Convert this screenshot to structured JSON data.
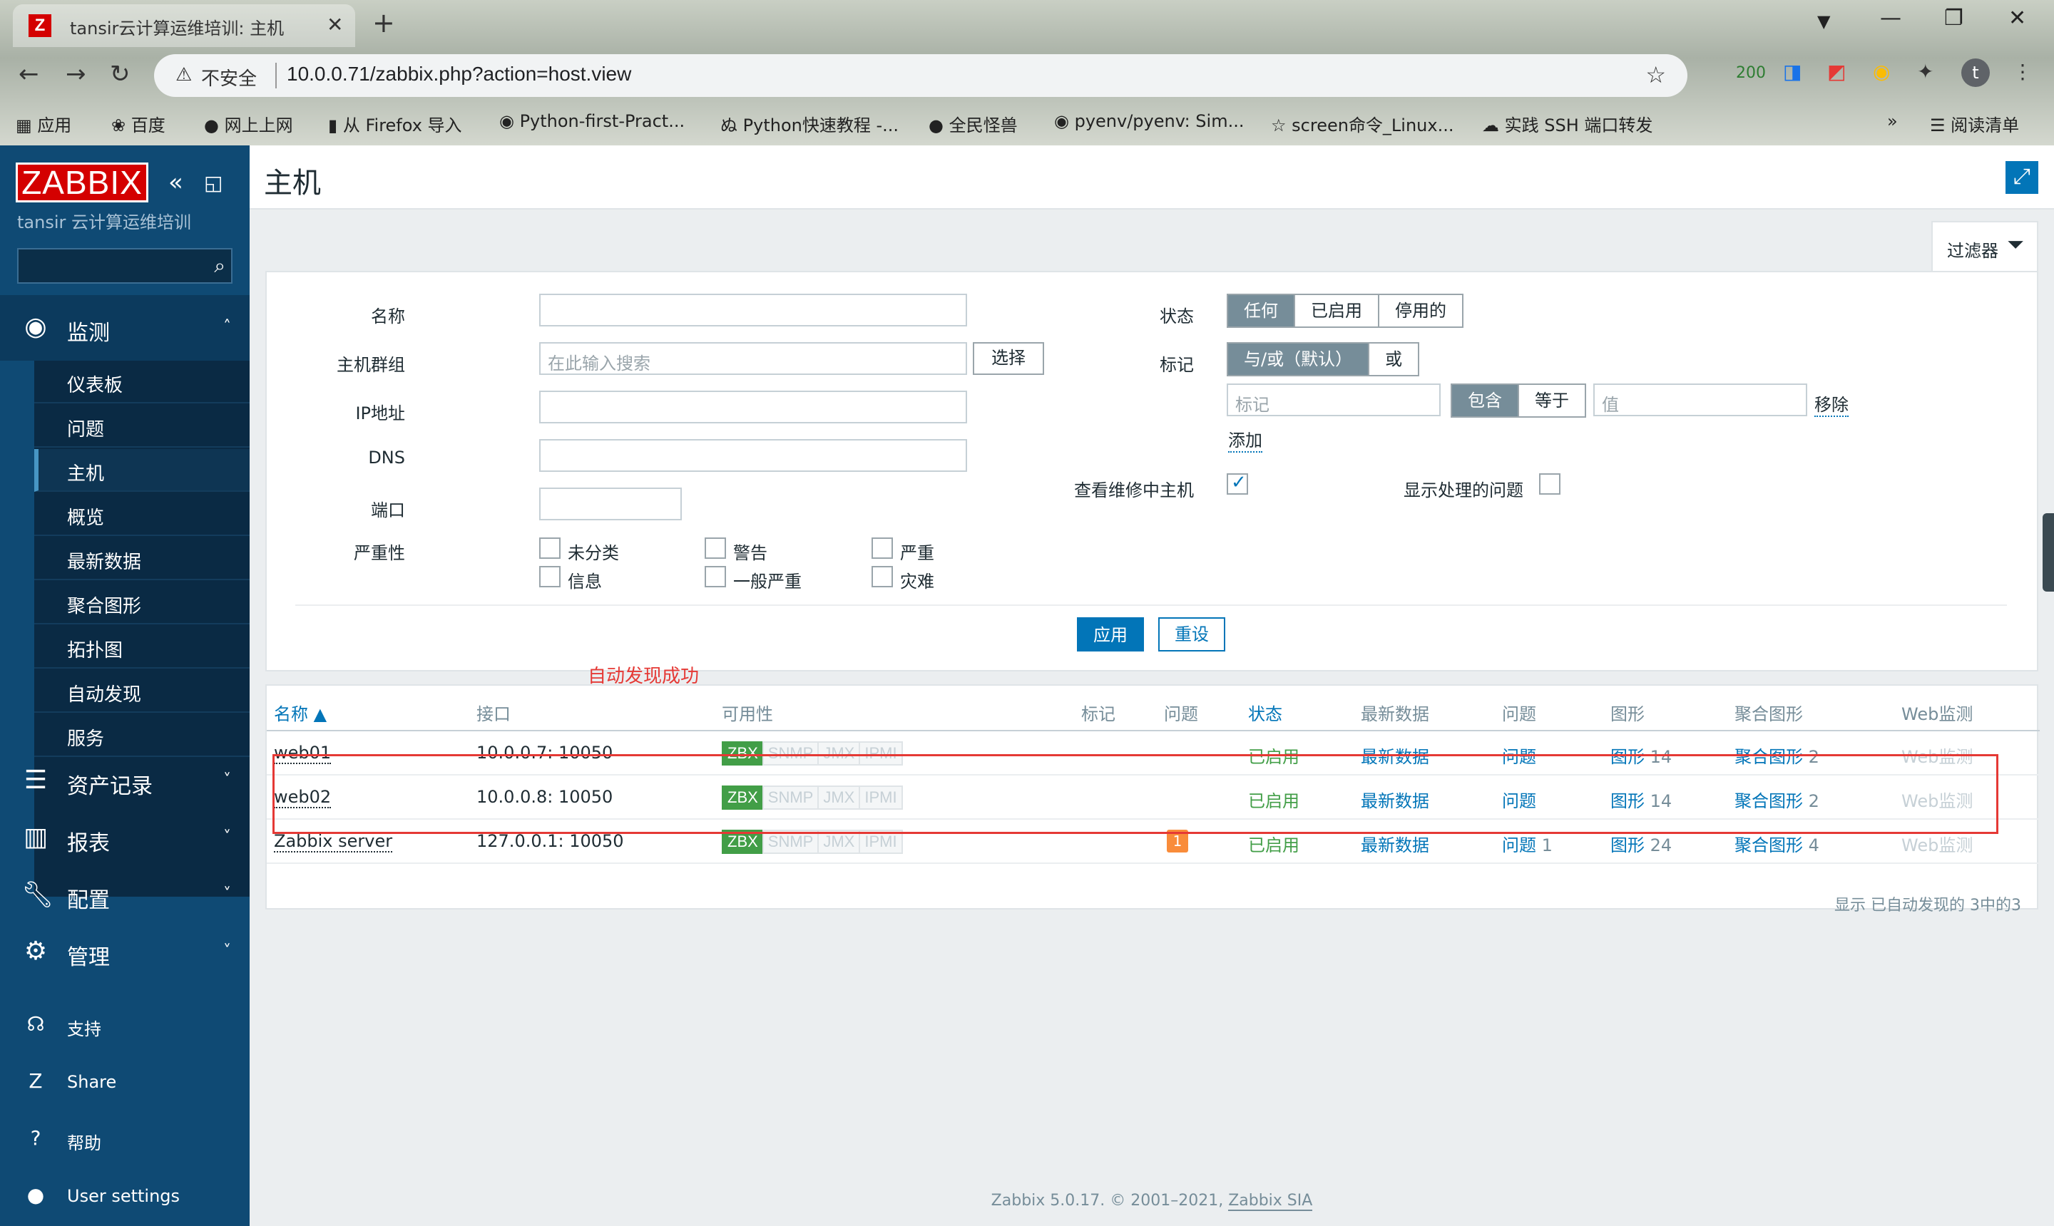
{
  "browser": {
    "tab_title": "tansir云计算运维培训: 主机",
    "new_tab": "+",
    "close_tab": "✕",
    "insecure_label": "不安全",
    "url": "10.0.0.71/zabbix.php?action=host.view",
    "ext_badge": "200",
    "bookmarks": [
      "应用",
      "百度",
      "网上上网",
      "从 Firefox 导入",
      "Python-first-Pract...",
      "Python快速教程 -...",
      "全民怪兽",
      "pyenv/pyenv: Sim...",
      "screen命令_Linux...",
      "实践 SSH 端口转发"
    ],
    "more_bookmarks": "»",
    "reading_list": "阅读清单"
  },
  "sidebar": {
    "logo": "ZABBIX",
    "subtitle": "tansir 云计算运维培训",
    "monitoring": "监测",
    "monitoring_items": [
      "仪表板",
      "问题",
      "主机",
      "概览",
      "最新数据",
      "聚合图形",
      "拓扑图",
      "自动发现",
      "服务"
    ],
    "active_item": "主机",
    "sections": [
      "资产记录",
      "报表",
      "配置",
      "管理"
    ],
    "bottom": [
      "支持",
      "Share",
      "帮助",
      "User settings"
    ]
  },
  "page": {
    "title": "主机",
    "filter_tab": "过滤器"
  },
  "filter": {
    "name_label": "名称",
    "hostgroup_label": "主机群组",
    "hostgroup_placeholder": "在此输入搜索",
    "select_btn": "选择",
    "ip_label": "IP地址",
    "dns_label": "DNS",
    "port_label": "端口",
    "severity_label": "严重性",
    "severities": [
      "未分类",
      "警告",
      "严重",
      "信息",
      "一般严重",
      "灾难"
    ],
    "status_label": "状态",
    "status_options": [
      "任何",
      "已启用",
      "停用的"
    ],
    "tags_label": "标记",
    "tag_mode_options": [
      "与/或（默认）",
      "或"
    ],
    "tag_placeholder": "标记",
    "tag_op_options": [
      "包含",
      "等于"
    ],
    "value_placeholder": "值",
    "remove": "移除",
    "add": "添加",
    "maintenance_label": "查看维修中主机",
    "maintenance_checked": true,
    "suppressed_label": "显示处理的问题",
    "apply": "应用",
    "reset": "重设"
  },
  "annotation": "自动发现成功",
  "table": {
    "headers": [
      "名称 ▲",
      "接口",
      "可用性",
      "标记",
      "问题",
      "状态",
      "最新数据",
      "问题",
      "图形",
      "聚合图形",
      "Web监测"
    ],
    "rows": [
      {
        "name": "web01",
        "iface": "10.0.0.7: 10050",
        "avail": [
          "ZBX",
          "SNMP",
          "JMX",
          "IPMI"
        ],
        "problems": "",
        "status": "已启用",
        "latest": "最新数据",
        "prob_link": "问题",
        "prob_count": "",
        "graphs": "图形",
        "graphs_n": "14",
        "screens": "聚合图形",
        "screens_n": "2",
        "web": "Web监测"
      },
      {
        "name": "web02",
        "iface": "10.0.0.8: 10050",
        "avail": [
          "ZBX",
          "SNMP",
          "JMX",
          "IPMI"
        ],
        "problems": "",
        "status": "已启用",
        "latest": "最新数据",
        "prob_link": "问题",
        "prob_count": "",
        "graphs": "图形",
        "graphs_n": "14",
        "screens": "聚合图形",
        "screens_n": "2",
        "web": "Web监测"
      },
      {
        "name": "Zabbix server",
        "iface": "127.0.0.1: 10050",
        "avail": [
          "ZBX",
          "SNMP",
          "JMX",
          "IPMI"
        ],
        "problems": "1",
        "status": "已启用",
        "latest": "最新数据",
        "prob_link": "问题",
        "prob_count": "1",
        "graphs": "图形",
        "graphs_n": "24",
        "screens": "聚合图形",
        "screens_n": "4",
        "web": "Web监测"
      }
    ],
    "footer": "显示 已自动发现的 3中的3"
  },
  "footer": {
    "text": "Zabbix 5.0.17. © 2001–2021,",
    "link": "Zabbix SIA"
  }
}
